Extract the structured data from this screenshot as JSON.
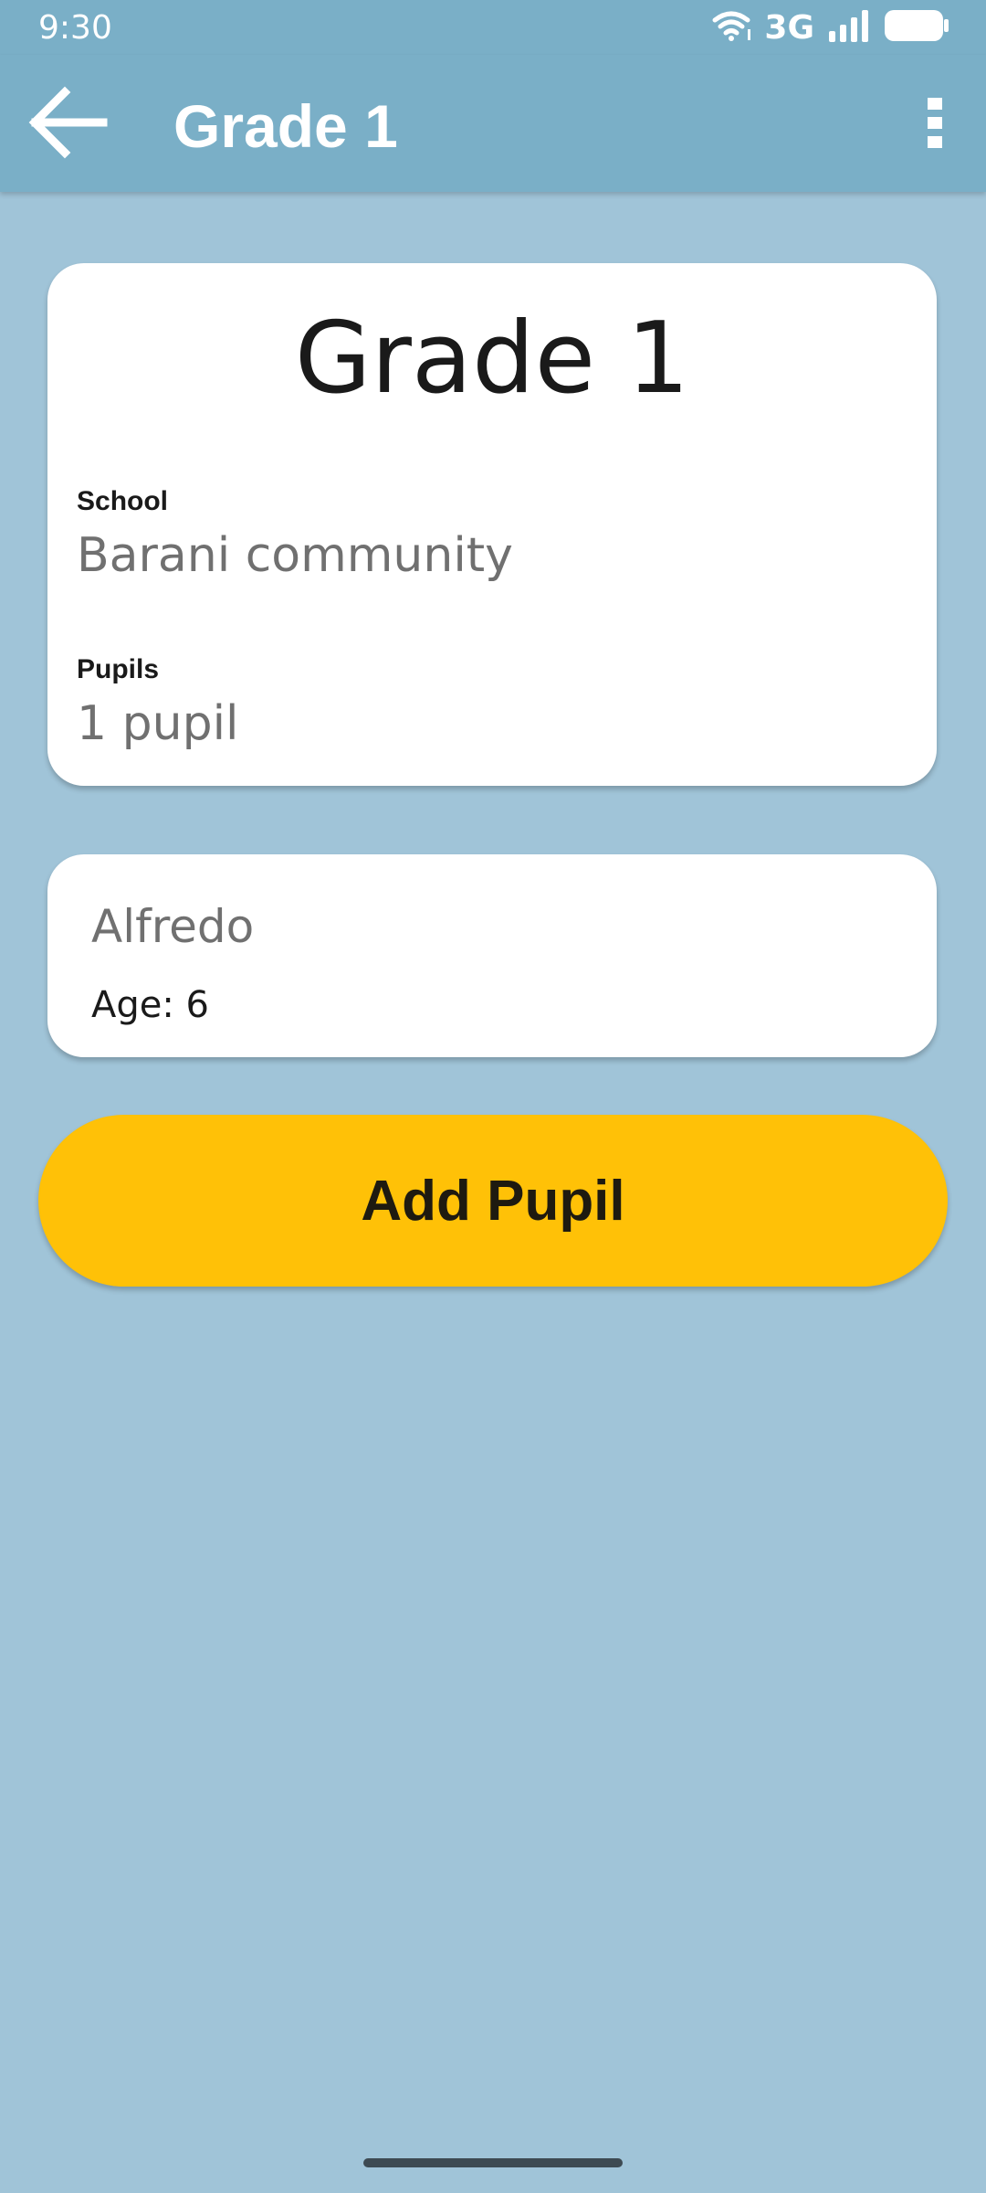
{
  "status_bar": {
    "time": "9:30",
    "network": "3G",
    "icons": [
      "wifi-icon",
      "signal-icon",
      "battery-icon"
    ]
  },
  "app_bar": {
    "title": "Grade 1",
    "back_icon": "arrow-back-icon",
    "menu_icon": "more-vert-icon"
  },
  "class_card": {
    "title": "Grade 1",
    "school_label": "School",
    "school_value": "Barani community",
    "pupils_label": "Pupils",
    "pupils_value": "1 pupil"
  },
  "pupils": [
    {
      "name": "Alfredo",
      "age_text": "Age: 6"
    }
  ],
  "actions": {
    "add_pupil_label": "Add Pupil"
  },
  "colors": {
    "app_bar": "#7aafc7",
    "background": "#a0c4d8",
    "accent": "#ffc107",
    "card": "#ffffff"
  }
}
